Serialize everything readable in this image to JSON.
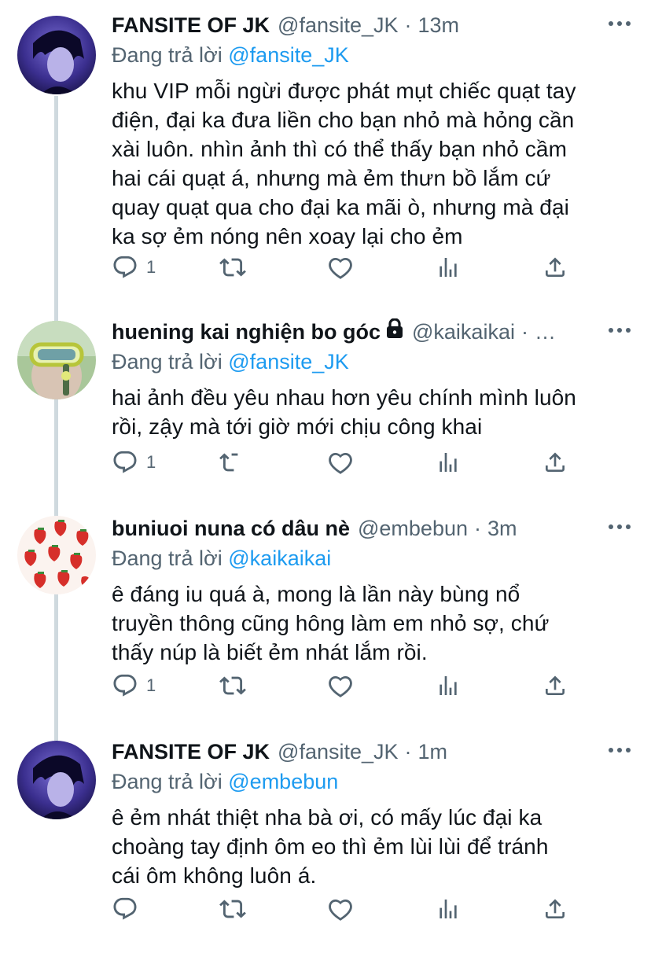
{
  "tweets": [
    {
      "name": "FANSITE OF JK",
      "handle": "@fansite_JK",
      "time": "13m",
      "reply_prefix": "Đang trả lời ",
      "reply_to": "@fansite_JK",
      "lines": [
        "khu VIP mỗi ngừi được phát mụt chiếc quạt tay",
        "điện, đại ka đưa liền cho bạn nhỏ mà hỏng cần",
        "xài luôn. nhìn ảnh thì có thể thấy bạn nhỏ cầm",
        "hai cái quạt á, nhưng mà ẻm thưn bồ lắm cứ",
        "quay quạt qua cho đại ka mãi ò, nhưng mà đại",
        "ka sợ ẻm nóng nên xoay lại cho ẻm"
      ],
      "reply_count": "1"
    },
    {
      "name": "huening kai nghiện bo góc",
      "handle": "@kaikaikai",
      "time": "…",
      "reply_prefix": "Đang trả lời ",
      "reply_to": "@fansite_JK",
      "lines": [
        "hai ảnh đều yêu nhau hơn yêu chính mình luôn",
        "rồi, zậy mà tới giờ mới chịu công khai"
      ],
      "reply_count": "1"
    },
    {
      "name": "buniuoi nuna có dâu nè",
      "handle": "@embebun",
      "time": "3m",
      "reply_prefix": "Đang trả lời ",
      "reply_to": "@kaikaikai",
      "lines": [
        "ê đáng iu quá à, mong là lần này bùng nổ",
        "truyền thông cũng hông làm em nhỏ sợ, chứ",
        "thấy núp là biết ẻm nhát lắm rồi."
      ],
      "reply_count": "1"
    },
    {
      "name": "FANSITE OF JK",
      "handle": "@fansite_JK",
      "time": "1m",
      "reply_prefix": "Đang trả lời ",
      "reply_to": "@embebun",
      "lines": [
        "ê ẻm nhát thiệt nha bà ơi, có mấy lúc đại ka",
        "choàng tay định ôm eo thì ẻm lùi lùi để tránh",
        "cái ôm không luôn á."
      ],
      "reply_count": ""
    }
  ],
  "icons": {
    "reply": "reply-icon",
    "retweet": "retweet-icon",
    "like": "heart-icon",
    "views": "analytics-icon",
    "share": "share-icon",
    "more": "more-icon",
    "lock": "lock-icon"
  },
  "colors": {
    "text": "#0f1419",
    "secondary": "#536471",
    "link": "#1d9bf0",
    "thread_line": "#cfd9de"
  }
}
